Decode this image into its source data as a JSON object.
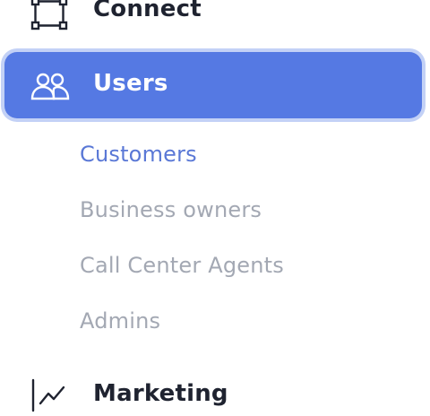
{
  "nav": {
    "connect": {
      "label": "Connect",
      "icon": "connect-icon"
    },
    "users": {
      "label": "Users",
      "icon": "users-icon",
      "active": true,
      "accent_color": "#5579e3",
      "children": [
        {
          "label": "Customers",
          "active": true
        },
        {
          "label": "Business owners",
          "active": false
        },
        {
          "label": "Call Center Agents",
          "active": false
        },
        {
          "label": "Admins",
          "active": false
        }
      ]
    },
    "marketing": {
      "label": "Marketing",
      "icon": "trend-line-icon"
    }
  },
  "colors": {
    "active_item_bg": "#5579e3",
    "active_subitem_text": "#5a78d6",
    "inactive_subitem_text": "#a3a8b3",
    "item_text": "#1f2330"
  }
}
